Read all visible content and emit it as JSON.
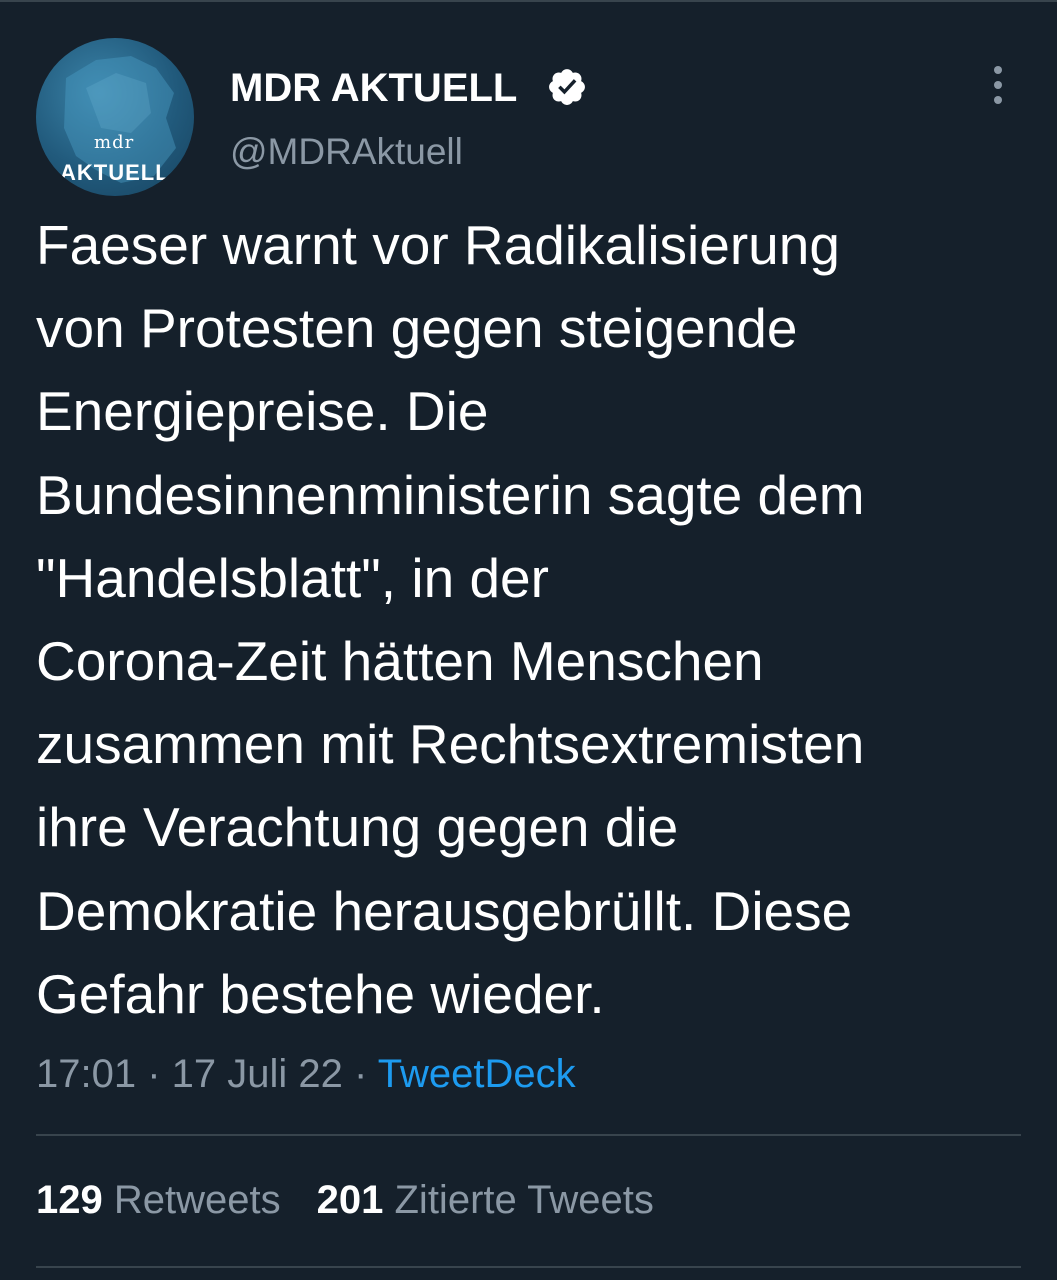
{
  "author": {
    "display_name": "MDR AKTUELL",
    "handle": "@MDRAktuell",
    "avatar_small_text": "mdr",
    "avatar_big_text": "AKTUELL",
    "verified": true
  },
  "tweet": {
    "text": "Faeser warnt vor Radikalisierung\nvon Protesten gegen steigende\nEnergiepreise. Die\nBundesinnenministerin sagte dem\n\"Handelsblatt\", in der\nCorona-Zeit hätten Menschen\nzusammen mit Rechtsextremisten\nihre Verachtung gegen die\nDemokratie herausgebrüllt. Diese\nGefahr bestehe wieder.",
    "time": "17:01",
    "date": "17 Juli 22",
    "source": "TweetDeck",
    "separator": " · "
  },
  "stats": {
    "retweets_count": "129",
    "retweets_label": "Retweets",
    "quotes_count": "201",
    "quotes_label": "Zitierte Tweets"
  },
  "colors": {
    "background": "#15202b",
    "text_primary": "#ffffff",
    "text_secondary": "#8b98a5",
    "link": "#1d9bf0",
    "border": "#38444d"
  },
  "icons": {
    "verified": "verified-badge-icon",
    "more": "more-options-icon"
  }
}
